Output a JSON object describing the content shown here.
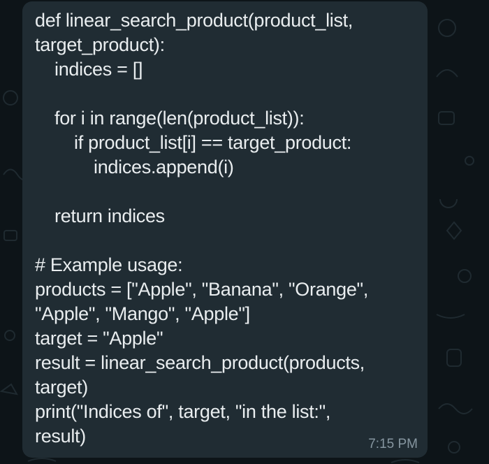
{
  "chat": {
    "background_color": "#0d1418",
    "bubble_color": "#202c33",
    "text_color": "#e9edef",
    "timestamp_color": "#8696a0",
    "message": {
      "lines": [
        "def linear_search_product(product_list,",
        "target_product):",
        "indices = []",
        "",
        "for i in range(len(product_list)):",
        "if product_list[i] == target_product:",
        "indices.append(i)",
        "",
        "return indices",
        "",
        "# Example usage:",
        "products = [\"Apple\", \"Banana\", \"Orange\",",
        "\"Apple\", \"Mango\", \"Apple\"]",
        "target = \"Apple\"",
        "result = linear_search_product(products,",
        "target)",
        "print(\"Indices of\", target, \"in the list:\",",
        "result)"
      ],
      "time": "7:15 PM"
    }
  }
}
